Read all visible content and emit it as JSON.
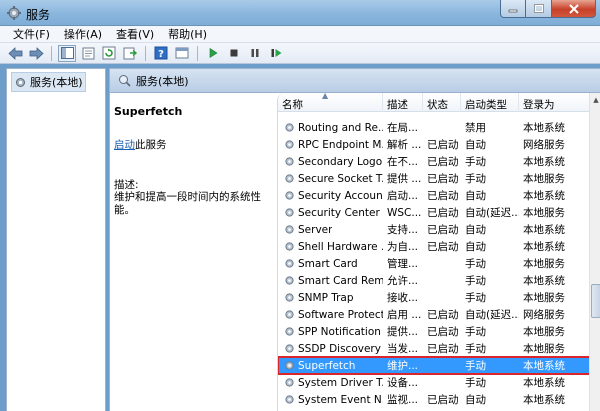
{
  "window": {
    "title": "服务"
  },
  "menubar": [
    "文件(F)",
    "操作(A)",
    "查看(V)",
    "帮助(H)"
  ],
  "toolbar": {
    "icons": [
      "back-arrow-icon",
      "forward-arrow-icon",
      "show-tree-icon",
      "properties-icon",
      "refresh-icon",
      "export-icon",
      "help-icon",
      "console-icon",
      "start-service-icon",
      "stop-service-icon",
      "pause-service-icon",
      "restart-service-icon"
    ]
  },
  "tree": {
    "root_label": "服务(本地)"
  },
  "main": {
    "header_label": "服务(本地)",
    "service_name": "Superfetch",
    "start_link": "启动",
    "start_suffix": "此服务",
    "desc_label": "描述:",
    "desc_text": "维护和提高一段时间内的系统性能。"
  },
  "list": {
    "columns": [
      "名称",
      "描述",
      "状态",
      "启动类型",
      "登录为"
    ],
    "rows": [
      {
        "name": "Routing and Re...",
        "desc": "在局...",
        "status": "",
        "start": "禁用",
        "logon": "本地系统"
      },
      {
        "name": "RPC Endpoint M...",
        "desc": "解析 ...",
        "status": "已启动",
        "start": "自动",
        "logon": "网络服务"
      },
      {
        "name": "Secondary Logon",
        "desc": "在不...",
        "status": "已启动",
        "start": "手动",
        "logon": "本地系统"
      },
      {
        "name": "Secure Socket T...",
        "desc": "提供 ...",
        "status": "已启动",
        "start": "手动",
        "logon": "本地服务"
      },
      {
        "name": "Security Account...",
        "desc": "启动...",
        "status": "已启动",
        "start": "自动",
        "logon": "本地系统"
      },
      {
        "name": "Security Center",
        "desc": "WSC...",
        "status": "已启动",
        "start": "自动(延迟...",
        "logon": "本地服务"
      },
      {
        "name": "Server",
        "desc": "支持...",
        "status": "已启动",
        "start": "自动",
        "logon": "本地系统"
      },
      {
        "name": "Shell Hardware ...",
        "desc": "为自...",
        "status": "已启动",
        "start": "自动",
        "logon": "本地系统"
      },
      {
        "name": "Smart Card",
        "desc": "管理...",
        "status": "",
        "start": "手动",
        "logon": "本地服务"
      },
      {
        "name": "Smart Card Rem...",
        "desc": "允许...",
        "status": "",
        "start": "手动",
        "logon": "本地系统"
      },
      {
        "name": "SNMP Trap",
        "desc": "接收...",
        "status": "",
        "start": "手动",
        "logon": "本地服务"
      },
      {
        "name": "Software Protect...",
        "desc": "启用 ...",
        "status": "已启动",
        "start": "自动(延迟...",
        "logon": "网络服务"
      },
      {
        "name": "SPP Notification ...",
        "desc": "提供...",
        "status": "已启动",
        "start": "手动",
        "logon": "本地服务"
      },
      {
        "name": "SSDP Discovery",
        "desc": "当发...",
        "status": "已启动",
        "start": "手动",
        "logon": "本地服务"
      },
      {
        "name": "Superfetch",
        "desc": "维护...",
        "status": "",
        "start": "手动",
        "logon": "本地系统",
        "selected": true
      },
      {
        "name": "System Driver T...",
        "desc": "设备...",
        "status": "",
        "start": "手动",
        "logon": "本地系统"
      },
      {
        "name": "System Event N...",
        "desc": "监视...",
        "status": "已启动",
        "start": "自动",
        "logon": "本地系统"
      }
    ]
  },
  "colors": {
    "selection": "#3399ff",
    "highlight_box": "#d9262c",
    "link": "#1a5fb4"
  }
}
